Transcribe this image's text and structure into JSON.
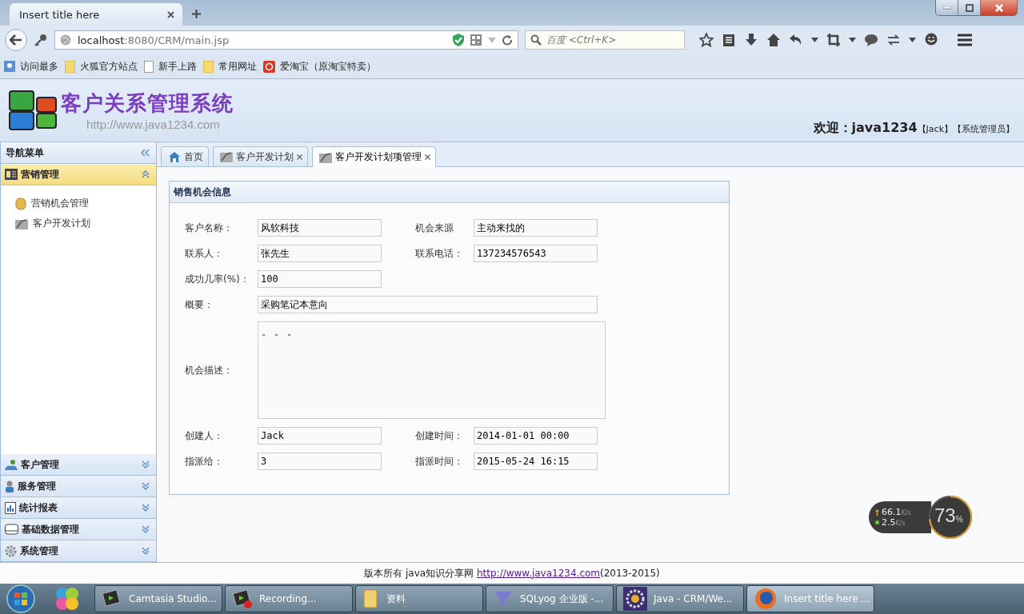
{
  "browser": {
    "tab": {
      "title": "Insert title here",
      "selected": true
    },
    "url": {
      "host": "localhost",
      "rest": ":8080/CRM/main.jsp"
    },
    "search": {
      "placeholder": "百度 <Ctrl+K>"
    },
    "bookmarks": [
      {
        "label": "访问最多",
        "kind": "most"
      },
      {
        "label": "火狐官方站点",
        "kind": "folder"
      },
      {
        "label": "新手上路",
        "kind": "page"
      },
      {
        "label": "常用网址",
        "kind": "folder"
      },
      {
        "label": "爱淘宝（原淘宝特卖）",
        "kind": "taobao"
      }
    ]
  },
  "header": {
    "title": "客户关系管理系统",
    "url": "http://www.java1234.com",
    "welcome": "欢迎：java1234",
    "user": "【Jack】",
    "role": "【系统管理员】"
  },
  "sidebar": {
    "title": "导航菜单",
    "sections": [
      {
        "label": "营销管理",
        "kind": "marketing",
        "expanded": true,
        "items": [
          {
            "label": "营销机会管理",
            "kind": "coins"
          },
          {
            "label": "客户开发计划",
            "kind": "plan"
          }
        ]
      },
      {
        "label": "客户管理",
        "kind": "customers",
        "expanded": false
      },
      {
        "label": "服务管理",
        "kind": "service",
        "expanded": false
      },
      {
        "label": "统计报表",
        "kind": "report",
        "expanded": false
      },
      {
        "label": "基础数据管理",
        "kind": "data",
        "expanded": false
      },
      {
        "label": "系统管理",
        "kind": "system",
        "expanded": false
      }
    ]
  },
  "tabs": [
    {
      "label": "首页",
      "kind": "home",
      "closable": false,
      "selected": false
    },
    {
      "label": "客户开发计划",
      "kind": "plan",
      "closable": true,
      "selected": false
    },
    {
      "label": "客户开发计划项管理",
      "kind": "plan",
      "closable": true,
      "selected": true
    }
  ],
  "form": {
    "title": "销售机会信息",
    "rows": [
      {
        "kind": "pair",
        "fields": [
          {
            "label": "客户名称：",
            "value": "风软科技"
          },
          {
            "label": "机会来源",
            "value": "主动来找的"
          }
        ]
      },
      {
        "kind": "pair",
        "fields": [
          {
            "label": "联系人：",
            "value": "张先生"
          },
          {
            "label": "联系电话：",
            "value": "137234576543"
          }
        ]
      },
      {
        "kind": "pair",
        "fields": [
          {
            "label": "成功几率(%)：",
            "value": "100"
          }
        ]
      },
      {
        "kind": "wide",
        "fields": [
          {
            "label": "概要：",
            "value": "采购笔记本意向"
          }
        ]
      },
      {
        "kind": "area",
        "fields": [
          {
            "label": "机会描述：",
            "value": "。 。 。"
          }
        ]
      },
      {
        "kind": "pair",
        "fields": [
          {
            "label": "创建人：",
            "value": "Jack"
          },
          {
            "label": "创建时间：",
            "value": "2014-01-01 00:00"
          }
        ]
      },
      {
        "kind": "pair",
        "fields": [
          {
            "label": "指派给：",
            "value": "3"
          },
          {
            "label": "指派时间：",
            "value": "2015-05-24 16:15"
          }
        ]
      }
    ]
  },
  "footer": {
    "text": "版本所有 java知识分享网 ",
    "link": "http://www.java1234.com",
    "years": "(2013-2015)"
  },
  "net_widget": {
    "up": "66.1",
    "up_unit": "K/s",
    "down": "2.5",
    "down_unit": "K/s",
    "percent": "73",
    "percent_sign": "%",
    "level": 0.73
  },
  "taskbar": [
    {
      "label": "Camtasia Studio...",
      "kind": "camtasia",
      "selected": false
    },
    {
      "label": "Recording...",
      "kind": "recording",
      "selected": false
    },
    {
      "label": "资料",
      "kind": "folder",
      "selected": false
    },
    {
      "label": "SQLyog 企业版 -...",
      "kind": "sqlyog",
      "selected": false
    },
    {
      "label": "Java - CRM/We...",
      "kind": "eclipse",
      "selected": false
    },
    {
      "label": "Insert title here ...",
      "kind": "firefox",
      "selected": true
    }
  ]
}
